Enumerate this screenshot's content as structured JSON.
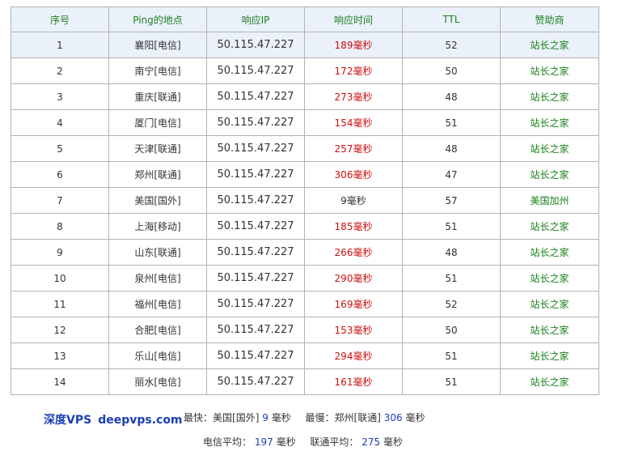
{
  "table": {
    "headers": [
      "序号",
      "Ping的地点",
      "响应IP",
      "响应时间",
      "TTL",
      "赞助商"
    ],
    "rows": [
      {
        "index": "1",
        "location": "襄阳[电信]",
        "ip": "50.115.47.227",
        "time": "189毫秒",
        "ttl": "52",
        "sponsor": "站长之家"
      },
      {
        "index": "2",
        "location": "南宁[电信]",
        "ip": "50.115.47.227",
        "time": "172毫秒",
        "ttl": "50",
        "sponsor": "站长之家"
      },
      {
        "index": "3",
        "location": "重庆[联通]",
        "ip": "50.115.47.227",
        "time": "273毫秒",
        "ttl": "48",
        "sponsor": "站长之家"
      },
      {
        "index": "4",
        "location": "厦门[电信]",
        "ip": "50.115.47.227",
        "time": "154毫秒",
        "ttl": "51",
        "sponsor": "站长之家"
      },
      {
        "index": "5",
        "location": "天津[联通]",
        "ip": "50.115.47.227",
        "time": "257毫秒",
        "ttl": "48",
        "sponsor": "站长之家"
      },
      {
        "index": "6",
        "location": "郑州[联通]",
        "ip": "50.115.47.227",
        "time": "306毫秒",
        "ttl": "47",
        "sponsor": "站长之家"
      },
      {
        "index": "7",
        "location": "美国[国外]",
        "ip": "50.115.47.227",
        "time": "9毫秒",
        "ttl": "57",
        "sponsor": "美国加州"
      },
      {
        "index": "8",
        "location": "上海[移动]",
        "ip": "50.115.47.227",
        "time": "185毫秒",
        "ttl": "51",
        "sponsor": "站长之家"
      },
      {
        "index": "9",
        "location": "山东[联通]",
        "ip": "50.115.47.227",
        "time": "266毫秒",
        "ttl": "48",
        "sponsor": "站长之家"
      },
      {
        "index": "10",
        "location": "泉州[电信]",
        "ip": "50.115.47.227",
        "time": "290毫秒",
        "ttl": "51",
        "sponsor": "站长之家"
      },
      {
        "index": "11",
        "location": "福州[电信]",
        "ip": "50.115.47.227",
        "time": "169毫秒",
        "ttl": "52",
        "sponsor": "站长之家"
      },
      {
        "index": "12",
        "location": "合肥[电信]",
        "ip": "50.115.47.227",
        "time": "153毫秒",
        "ttl": "50",
        "sponsor": "站长之家"
      },
      {
        "index": "13",
        "location": "乐山[电信]",
        "ip": "50.115.47.227",
        "time": "294毫秒",
        "ttl": "51",
        "sponsor": "站长之家"
      },
      {
        "index": "14",
        "location": "丽水[电信]",
        "ip": "50.115.47.227",
        "time": "161毫秒",
        "ttl": "51",
        "sponsor": "站长之家"
      }
    ]
  },
  "brand": {
    "name": "深度VPS",
    "domain": "deepvps.com"
  },
  "summary": {
    "fastest_label": "最快：",
    "fastest_location": "美国[国外]",
    "fastest_value": "9",
    "fastest_unit": "毫秒",
    "slowest_label": "最慢：",
    "slowest_location": "郑州[联通]",
    "slowest_value": "306",
    "slowest_unit": "毫秒",
    "telecom_avg_label": "电信平均：",
    "telecom_avg_value": "197",
    "telecom_avg_unit": "毫秒",
    "unicom_avg_label": "联通平均：",
    "unicom_avg_value": "275",
    "unicom_avg_unit": "毫秒"
  },
  "colors": {
    "header_bg": "#eaf1fb",
    "header_text": "#1f7f1f",
    "slow_time": "#cc1111",
    "sponsor": "#1a801a",
    "brand": "#1b40b5",
    "border": "#b3b3b3"
  }
}
